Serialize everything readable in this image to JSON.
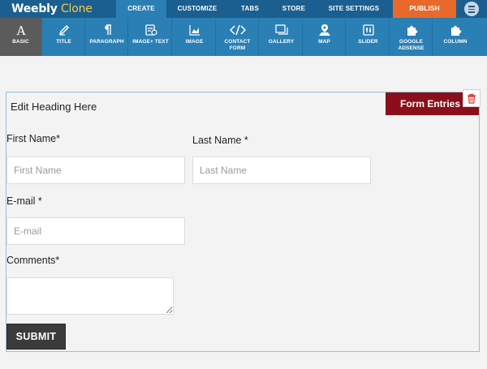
{
  "app": {
    "logo_main": "Weebly",
    "logo_suffix": " Clone"
  },
  "nav": {
    "tabs": [
      {
        "label": "CREATE",
        "active": true
      },
      {
        "label": "CUSTOMIZE",
        "active": false
      },
      {
        "label": "TABS",
        "active": false
      },
      {
        "label": "STORE",
        "active": false
      },
      {
        "label": "SITE SETTINGS",
        "active": false
      }
    ],
    "publish_label": "PUBLISH",
    "menu_icon": "hamburger-menu-icon"
  },
  "toolbar": {
    "items": [
      {
        "label": "BASIC",
        "icon": "text-font-icon",
        "active": true
      },
      {
        "label": "TITLE",
        "icon": "pen-icon",
        "active": false
      },
      {
        "label": "PARAGRAPH",
        "icon": "pilcrow-icon",
        "active": false
      },
      {
        "label": "IMAGE+ TEXT",
        "icon": "image-text-icon",
        "active": false
      },
      {
        "label": "IMAGE",
        "icon": "image-chart-icon",
        "active": false
      },
      {
        "label": "CONTACT FORM",
        "icon": "code-icon",
        "active": false
      },
      {
        "label": "GALLERY",
        "icon": "gallery-icon",
        "active": false
      },
      {
        "label": "MAP",
        "icon": "map-icon",
        "active": false
      },
      {
        "label": "SLIDER",
        "icon": "slider-icon",
        "active": false
      },
      {
        "label": "GOOGLE ADSENSE",
        "icon": "puzzle-icon",
        "active": false
      },
      {
        "label": "COLUMN",
        "icon": "puzzle-icon",
        "active": false
      }
    ]
  },
  "form": {
    "heading": "Edit Heading Here",
    "entries_label": "Form Entries",
    "delete_icon": "trash-icon",
    "fields": {
      "first_name": {
        "label": "First Name*",
        "placeholder": "First Name",
        "value": ""
      },
      "last_name": {
        "label": "Last Name *",
        "placeholder": "Last Name",
        "value": ""
      },
      "email": {
        "label": "E-mail *",
        "placeholder": "E-mail",
        "value": ""
      },
      "comments": {
        "label": "Comments*",
        "placeholder": "",
        "value": ""
      }
    },
    "submit_label": "SUBMIT"
  },
  "colors": {
    "nav_bg": "#1a5f8f",
    "toolbar_bg": "#2a7fb4",
    "active_tool": "#5b5b5b",
    "publish": "#e8692a",
    "logo_accent": "#f7c93e",
    "entries_bg": "#8b0f1a",
    "submit_bg": "#3b3b3b",
    "form_border": "#8cc3e3"
  }
}
